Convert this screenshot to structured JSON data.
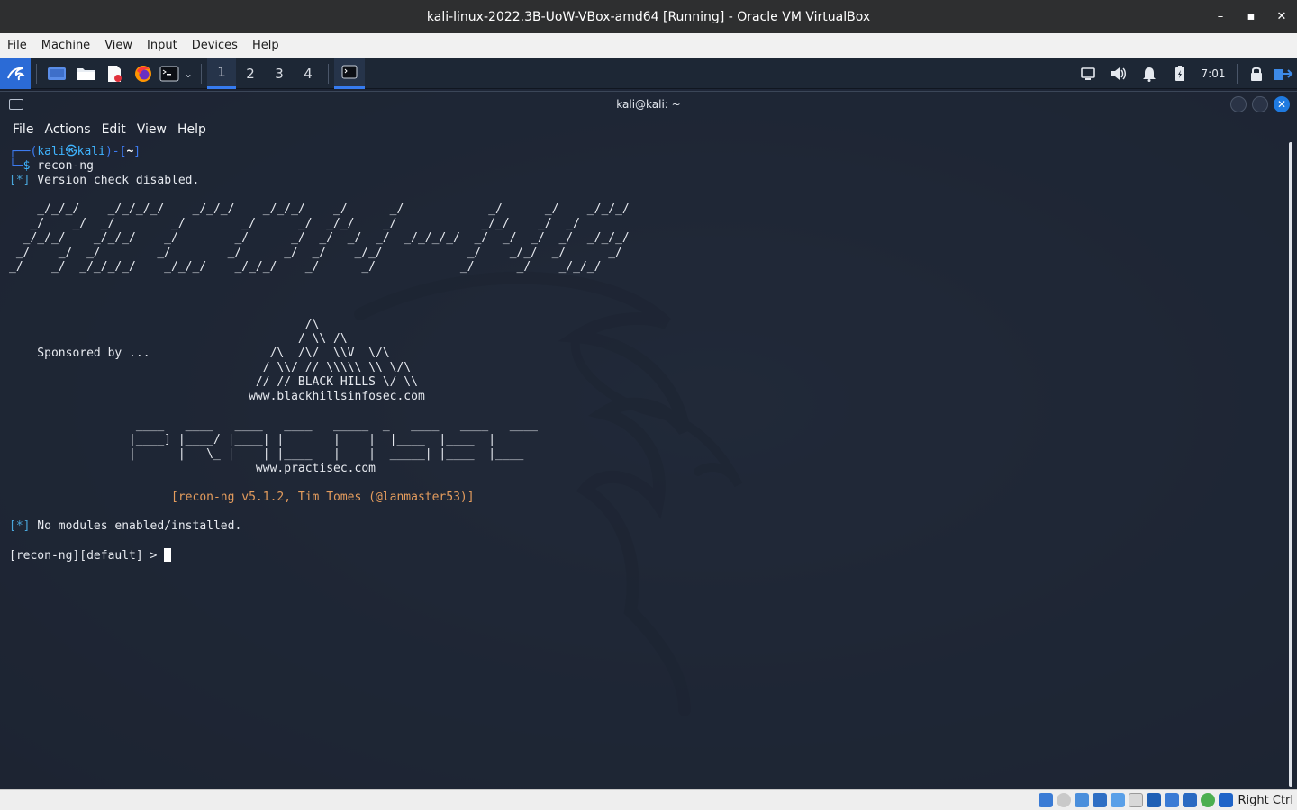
{
  "vbox": {
    "title": "kali-linux-2022.3B-UoW-VBox-amd64 [Running] - Oracle VM VirtualBox",
    "controls": {
      "minimize": "–",
      "maximize": "▪",
      "close": "✕"
    },
    "menu": [
      "File",
      "Machine",
      "View",
      "Input",
      "Devices",
      "Help"
    ],
    "status": {
      "host_key": "Right Ctrl"
    }
  },
  "panel": {
    "workspaces": [
      "1",
      "2",
      "3",
      "4"
    ],
    "active_workspace": "1",
    "clock": "7:01",
    "accent_color": "#367bf0"
  },
  "terminal": {
    "title": "kali@kali: ~",
    "menu": [
      "File",
      "Actions",
      "Edit",
      "View",
      "Help"
    ],
    "prompt": {
      "open": "┌──(",
      "user": "kali",
      "at": "㉿",
      "host": "kali",
      "mid": ")-[",
      "dir": "~",
      "close": "]",
      "line2_prefix": "└─",
      "dollar": "$",
      "command": " recon-ng"
    },
    "version_check": {
      "tag": "[*]",
      "text": " Version check disabled."
    },
    "banner": [
      "    _/_/_/    _/_/_/_/    _/_/_/    _/_/_/    _/      _/            _/      _/    _/_/_/",
      "   _/    _/  _/        _/        _/      _/  _/_/    _/            _/_/    _/  _/       ",
      "  _/_/_/    _/_/_/    _/        _/      _/  _/  _/  _/  _/_/_/_/  _/  _/  _/  _/  _/_/_/",
      " _/    _/  _/        _/        _/      _/  _/    _/_/            _/    _/_/  _/      _/ ",
      "_/    _/  _/_/_/_/    _/_/_/    _/_/_/    _/      _/            _/      _/    _/_/_/    "
    ],
    "sponsor": [
      "                                          /\\",
      "                                         / \\\\ /\\",
      "    Sponsored by ...                 /\\  /\\/  \\\\V  \\/\\",
      "                                    / \\\\/ // \\\\\\\\\\ \\\\ \\/\\",
      "                                   // // BLACK HILLS \\/ \\\\",
      "                                  www.blackhillsinfosec.com"
    ],
    "practisec": [
      "                  ____   ____   ____   ____   _____  _   ____   ____   ____",
      "                 |____] |____/ |____| |       |    |  |____  |____  |",
      "                 |      |   \\_ |    | |____   |    |  _____| |____  |____",
      "                                   www.practisec.com"
    ],
    "version_line": "                       [recon-ng v5.1.2, Tim Tomes (@lanmaster53)]",
    "modules": {
      "tag": "[*]",
      "text": " No modules enabled/installed."
    },
    "recon_prompt": "[recon-ng][default] > "
  }
}
